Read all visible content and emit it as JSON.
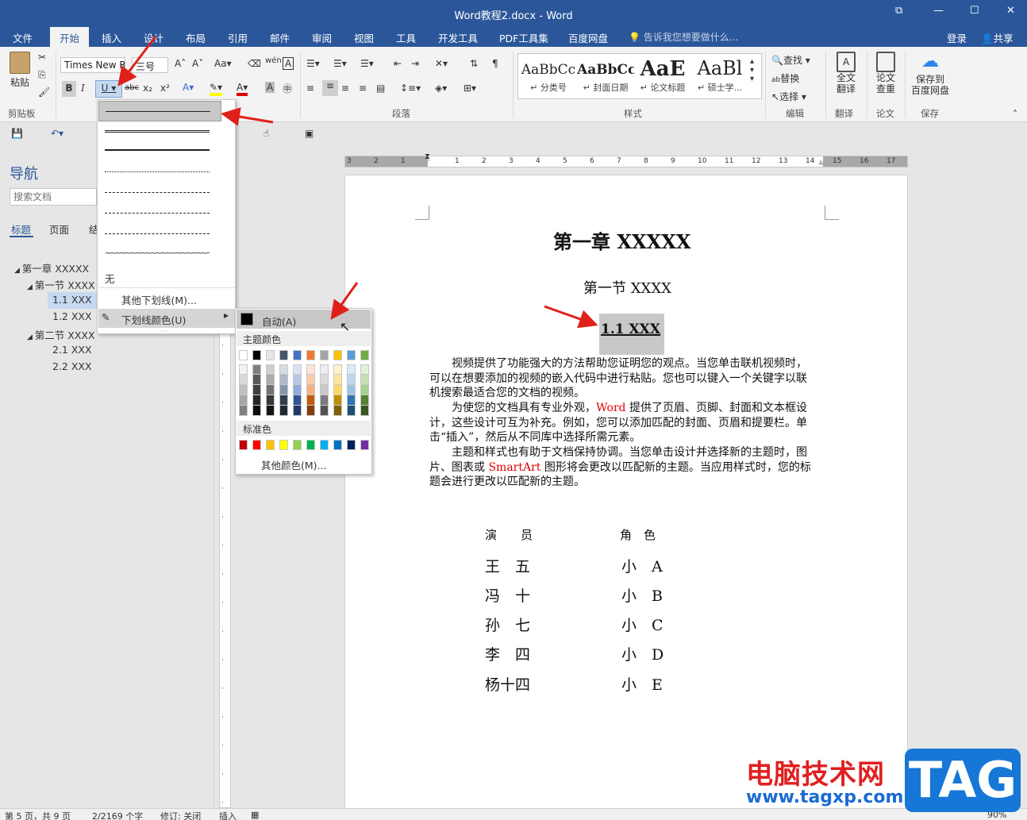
{
  "window": {
    "title": "Word教程2.docx - Word"
  },
  "tabs": [
    "文件",
    "开始",
    "插入",
    "设计",
    "布局",
    "引用",
    "邮件",
    "审阅",
    "视图",
    "工具",
    "开发工具",
    "PDF工具集",
    "百度网盘"
  ],
  "tell_me": "告诉我您想要做什么...",
  "account": {
    "signin": "登录",
    "share": "共享"
  },
  "ribbon": {
    "paste": "粘贴",
    "font_name": "Times New R",
    "font_size": "三号",
    "bold": "B",
    "italic": "I",
    "underline": "U",
    "strike": "abc",
    "sub": "x₂",
    "sup": "x²",
    "styles": [
      {
        "sample": "AaBbCc",
        "label": "↵ 分类号"
      },
      {
        "sample": "AaBbCc",
        "label": "↵ 封面日期"
      },
      {
        "sample": "AaE",
        "label": "↵ 论文标题"
      },
      {
        "sample": "AaBl",
        "label": "↵ 硕士学..."
      }
    ],
    "find": "查找",
    "replace": "替换",
    "select": "选择",
    "full_translate": "全文\n翻译",
    "paper_check": "论文\n查重",
    "save_baidu": "保存到\n百度网盘",
    "groups": {
      "clipboard": "剪贴板",
      "paragraph": "段落",
      "styles": "样式",
      "edit": "编辑",
      "translate": "翻译",
      "paper": "论文",
      "save": "保存"
    }
  },
  "nav": {
    "title": "导航",
    "search_placeholder": "搜索文档",
    "tabs": [
      "标题",
      "页面",
      "结"
    ],
    "tree": [
      {
        "label": "第一章 XXXXX",
        "level": 0
      },
      {
        "label": "第一节 XXXX",
        "level": 1
      },
      {
        "label": "1.1 XXX",
        "level": 2,
        "selected": true
      },
      {
        "label": "1.2 XXX",
        "level": 2
      },
      {
        "label": "第二节 XXXX",
        "level": 1
      },
      {
        "label": "2.1 XXX",
        "level": 2
      },
      {
        "label": "2.2 XXX",
        "level": 2
      }
    ]
  },
  "ruler": {
    "ticks": [
      "3",
      "2",
      "1",
      "",
      "1",
      "2",
      "3",
      "4",
      "5",
      "6",
      "7",
      "8",
      "9",
      "10",
      "11",
      "12",
      "13",
      "14",
      "15",
      "16",
      "17"
    ]
  },
  "underline_menu": {
    "none": "无",
    "more": "其他下划线(M)...",
    "color": "下划线颜色(U)"
  },
  "color_menu": {
    "auto": "自动(A)",
    "theme": "主题颜色",
    "standard": "标准色",
    "more": "其他颜色(M)...",
    "theme_top": [
      "#ffffff",
      "#000000",
      "#e7e6e6",
      "#44546a",
      "#4472c4",
      "#ed7d31",
      "#a5a5a5",
      "#ffc000",
      "#5b9bd5",
      "#70ad47"
    ],
    "theme_cols": [
      [
        "#f2f2f2",
        "#d9d9d9",
        "#bfbfbf",
        "#a6a6a6",
        "#808080"
      ],
      [
        "#808080",
        "#595959",
        "#404040",
        "#262626",
        "#0d0d0d"
      ],
      [
        "#d0cece",
        "#aeabab",
        "#757171",
        "#3a3838",
        "#171616"
      ],
      [
        "#d6dce5",
        "#adb9ca",
        "#8497b0",
        "#333f50",
        "#222a35"
      ],
      [
        "#dae3f3",
        "#b4c7e7",
        "#8faadc",
        "#2f5597",
        "#1f3864"
      ],
      [
        "#fbe5d6",
        "#f8cbad",
        "#f4b183",
        "#c55a11",
        "#843c0c"
      ],
      [
        "#ededed",
        "#dbdbdb",
        "#c9c9c9",
        "#7b7b7b",
        "#525252"
      ],
      [
        "#fff2cc",
        "#ffe699",
        "#ffd966",
        "#bf9000",
        "#7f6000"
      ],
      [
        "#deebf7",
        "#bdd7ee",
        "#9dc3e6",
        "#2e75b6",
        "#1f4e79"
      ],
      [
        "#e2f0d9",
        "#c5e0b4",
        "#a9d18e",
        "#548235",
        "#385723"
      ]
    ],
    "standard_colors": [
      "#c00000",
      "#ff0000",
      "#ffc000",
      "#ffff00",
      "#92d050",
      "#00b050",
      "#00b0f0",
      "#0070c0",
      "#002060",
      "#7030a0"
    ]
  },
  "document": {
    "chapter": "第一章  XXXXX",
    "section": "第一节  XXXX",
    "heading": "1.1 XXX",
    "p1": [
      "　　视频提供了功能强大的方法帮助您证明您的观点。当您单击联机视频时，",
      "可以在想要添加的视频的嵌入代码中进行粘贴。您也可以键入一个关键字以联",
      "机搜索最适合您的文档的视频。"
    ],
    "p2a": "　　为使您的文档具有专业外观，",
    "p2word": "Word",
    "p2b": " 提供了页眉、页脚、封面和文本框设",
    "p2": [
      "计，这些设计可互为补充。例如，您可以添加匹配的封面、页眉和提要栏。单",
      "击“插入”，然后从不同库中选择所需元素。"
    ],
    "p3a": "　　主题和样式也有助于文档保持协调。当您单击设计并选择新的主题时，图",
    "p3b": "片、图表或 ",
    "p3smart": "SmartArt",
    "p3c": " 图形将会更改以匹配新的主题。当应用样式时，您的标",
    "p3d": "题会进行更改以匹配新的主题。",
    "table_head": [
      "演　　员",
      "角　色"
    ],
    "table_rows": [
      [
        "王　五",
        "小　A"
      ],
      [
        "冯　十",
        "小　B"
      ],
      [
        "孙　七",
        "小　C"
      ],
      [
        "李　四",
        "小　D"
      ],
      [
        "杨十四",
        "小　E"
      ]
    ]
  },
  "status": {
    "page": "第 5 页，共 9 页",
    "words": "2/2169 个字",
    "track": "修订: 关闭",
    "mode": "插入",
    "zoom": "90%"
  },
  "watermark": {
    "text": "电脑技术网",
    "url": "www.tagxp.com",
    "tag": "TAG"
  },
  "colors": {
    "accent": "#2b579a",
    "selection": "#c5d9f1",
    "arrow": "#e0201a"
  }
}
